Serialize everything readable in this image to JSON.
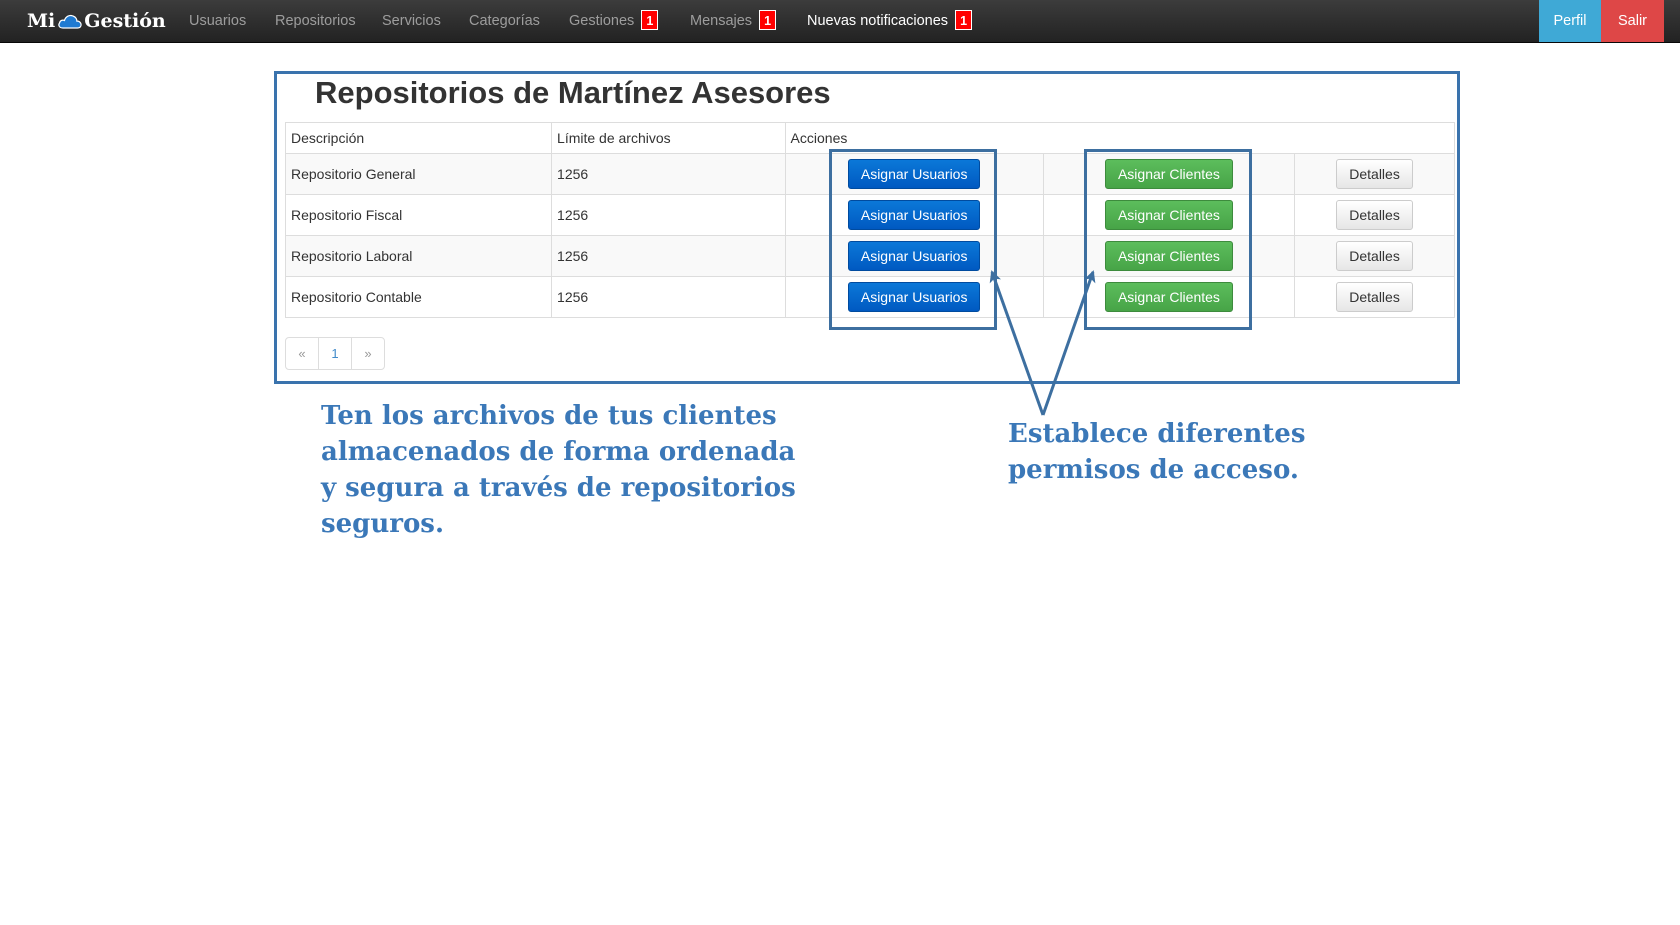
{
  "navbar": {
    "brand_left": "Mi",
    "brand_right": "Gestión",
    "items": [
      {
        "label": "Usuarios"
      },
      {
        "label": "Repositorios"
      },
      {
        "label": "Servicios"
      },
      {
        "label": "Categorías"
      },
      {
        "label": "Gestiones",
        "badge": "1"
      },
      {
        "label": "Mensajes",
        "badge": "1"
      },
      {
        "label": "Nuevas notificaciones",
        "badge": "1"
      }
    ],
    "perfil": "Perfil",
    "salir": "Salir"
  },
  "page": {
    "title": "Repositorios de Martínez Asesores"
  },
  "table": {
    "headers": {
      "description": "Descripción",
      "limit": "Límite de archivos",
      "actions": "Acciones"
    },
    "rows": [
      {
        "description": "Repositorio General",
        "limit": "1256",
        "assign_users": "Asignar Usuarios",
        "assign_clients": "Asignar Clientes",
        "details": "Detalles"
      },
      {
        "description": "Repositorio Fiscal",
        "limit": "1256",
        "assign_users": "Asignar Usuarios",
        "assign_clients": "Asignar Clientes",
        "details": "Detalles"
      },
      {
        "description": "Repositorio Laboral",
        "limit": "1256",
        "assign_users": "Asignar Usuarios",
        "assign_clients": "Asignar Clientes",
        "details": "Detalles"
      },
      {
        "description": "Repositorio Contable",
        "limit": "1256",
        "assign_users": "Asignar Usuarios",
        "assign_clients": "Asignar Clientes",
        "details": "Detalles"
      }
    ]
  },
  "pagination": {
    "prev": "«",
    "current": "1",
    "next": "»"
  },
  "callouts": {
    "left": "Ten los archivos de tus clientes almacenados de forma ordenada y segura a través de repositorios seguros.",
    "right": "Establece diferentes permisos de acceso."
  },
  "colors": {
    "annotation": "#3b78b8",
    "badge": "#ff0000",
    "perfil": "#3fa9d6",
    "salir": "#de4747",
    "assign_users": "#0066cc",
    "assign_clients": "#4cae4c"
  },
  "icons": {
    "brand": "cloud-icon"
  }
}
